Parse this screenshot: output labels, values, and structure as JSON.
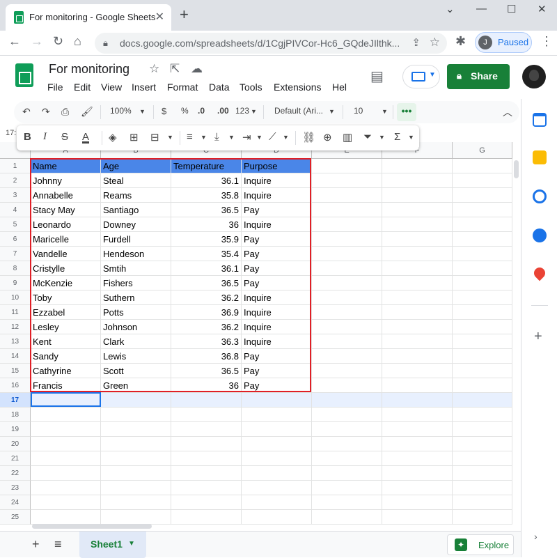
{
  "browser": {
    "tab_title": "For monitoring - Google Sheets",
    "tab_close": "✕",
    "new_tab": "+",
    "url": "docs.google.com/spreadsheets/d/1CgjPIVCor-Hc6_GQdeJIlthk...",
    "profile_initial": "J",
    "profile_status": "Paused"
  },
  "doc": {
    "title": "For monitoring",
    "menus": [
      "File",
      "Edit",
      "View",
      "Insert",
      "Format",
      "Data",
      "Tools",
      "Extensions",
      "Hel"
    ],
    "share_label": "Share"
  },
  "toolbar": {
    "zoom": "100%",
    "currency": "$",
    "percent": "%",
    "dec_decrease": ".0",
    "dec_increase": ".00",
    "more_formats": "123",
    "font": "Default (Ari...",
    "font_size": "10",
    "more": "•••"
  },
  "name_box": "17:",
  "grid": {
    "columns": [
      "A",
      "B",
      "C",
      "D",
      "E",
      "F",
      "G"
    ],
    "rows": [
      [
        "Name",
        "Age",
        "Temperature",
        "Purpose"
      ],
      [
        "Johnny",
        "Steal",
        "36.1",
        "Inquire"
      ],
      [
        "Annabelle",
        "Reams",
        "35.8",
        "Inquire"
      ],
      [
        "Stacy May",
        "Santiago",
        "36.5",
        "Pay"
      ],
      [
        "Leonardo",
        "Downey",
        "36",
        "Inquire"
      ],
      [
        "Maricelle",
        "Furdell",
        "35.9",
        "Pay"
      ],
      [
        "Vandelle",
        "Hendeson",
        "35.4",
        "Pay"
      ],
      [
        "Cristylle",
        "Smtih",
        "36.1",
        "Pay"
      ],
      [
        "McKenzie",
        "Fishers",
        "36.5",
        "Pay"
      ],
      [
        "Toby",
        "Suthern",
        "36.2",
        "Inquire"
      ],
      [
        "Ezzabel",
        "Potts",
        "36.9",
        "Inquire"
      ],
      [
        "Lesley",
        "Johnson",
        "36.2",
        "Inquire"
      ],
      [
        "Kent",
        "Clark",
        "36.3",
        "Inquire"
      ],
      [
        "Sandy",
        "Lewis",
        "36.8",
        "Pay"
      ],
      [
        "Cathyrine",
        "Scott",
        "36.5",
        "Pay"
      ],
      [
        "Francis",
        "Green",
        "36",
        "Pay"
      ]
    ],
    "row_numbers": [
      "1",
      "2",
      "3",
      "4",
      "5",
      "6",
      "7",
      "8",
      "9",
      "10",
      "11",
      "12",
      "13",
      "14",
      "15",
      "16",
      "17",
      "18",
      "19",
      "20",
      "21",
      "22",
      "23",
      "24",
      "25"
    ],
    "selected_row": "17"
  },
  "bottom": {
    "sheet_tab": "Sheet1",
    "explore_label": "Explore"
  },
  "colors": {
    "header_fill": "#4a86e8",
    "highlight_border": "#e01f26",
    "share_green": "#188038"
  }
}
